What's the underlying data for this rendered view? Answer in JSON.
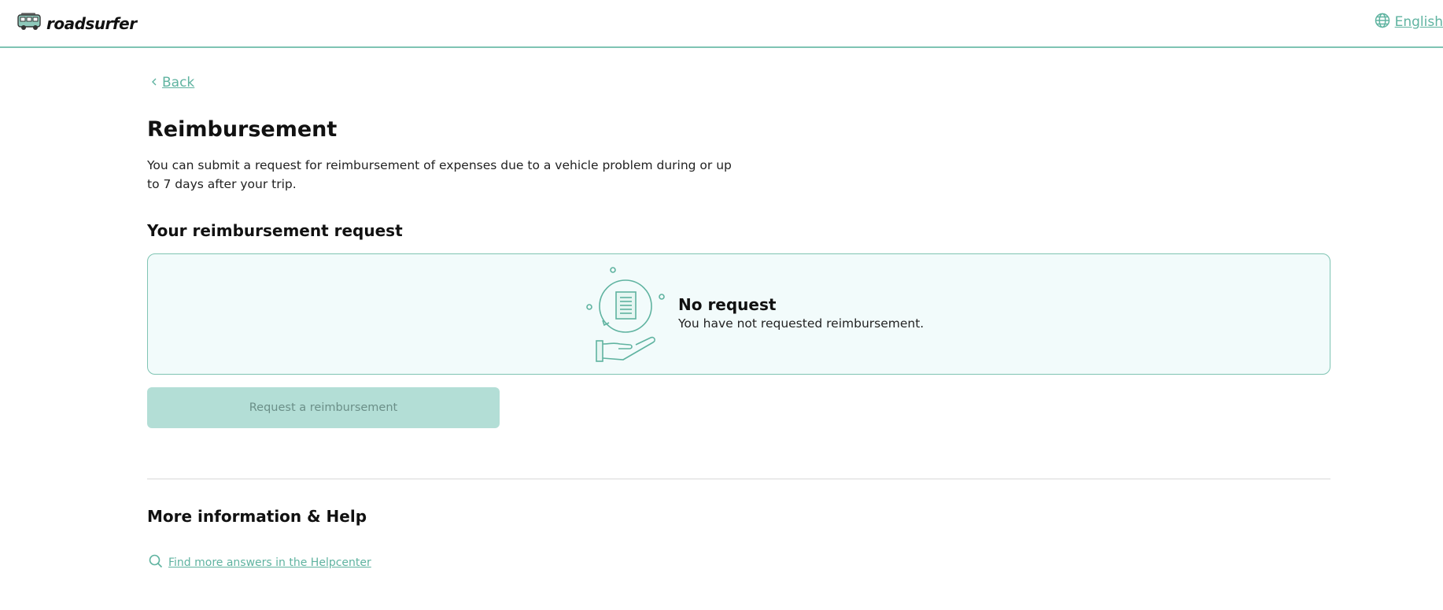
{
  "header": {
    "logo_text": "roadsurfer",
    "language_label": "English"
  },
  "nav": {
    "back_label": "Back"
  },
  "page": {
    "title": "Reimbursement",
    "description": "You can submit a request for reimbursement of expenses due to a vehicle problem during or up to 7 days after your trip.",
    "section_title": "Your reimbursement request"
  },
  "card": {
    "title": "No request",
    "subtitle": "You have not requested reimbursement."
  },
  "actions": {
    "request_label": "Request a reimbursement"
  },
  "help": {
    "title": "More information & Help",
    "link_label": "Find more answers in the Helpcenter"
  },
  "icons": [
    "van-logo-icon",
    "globe-icon",
    "chevron-left-icon",
    "reimbursement-illustration-icon",
    "search-icon"
  ],
  "colors": {
    "accent": "#5fb3a0",
    "border": "#7fc4b3",
    "card_bg": "#f2fbfb",
    "button_disabled_bg": "#b3ded6"
  }
}
